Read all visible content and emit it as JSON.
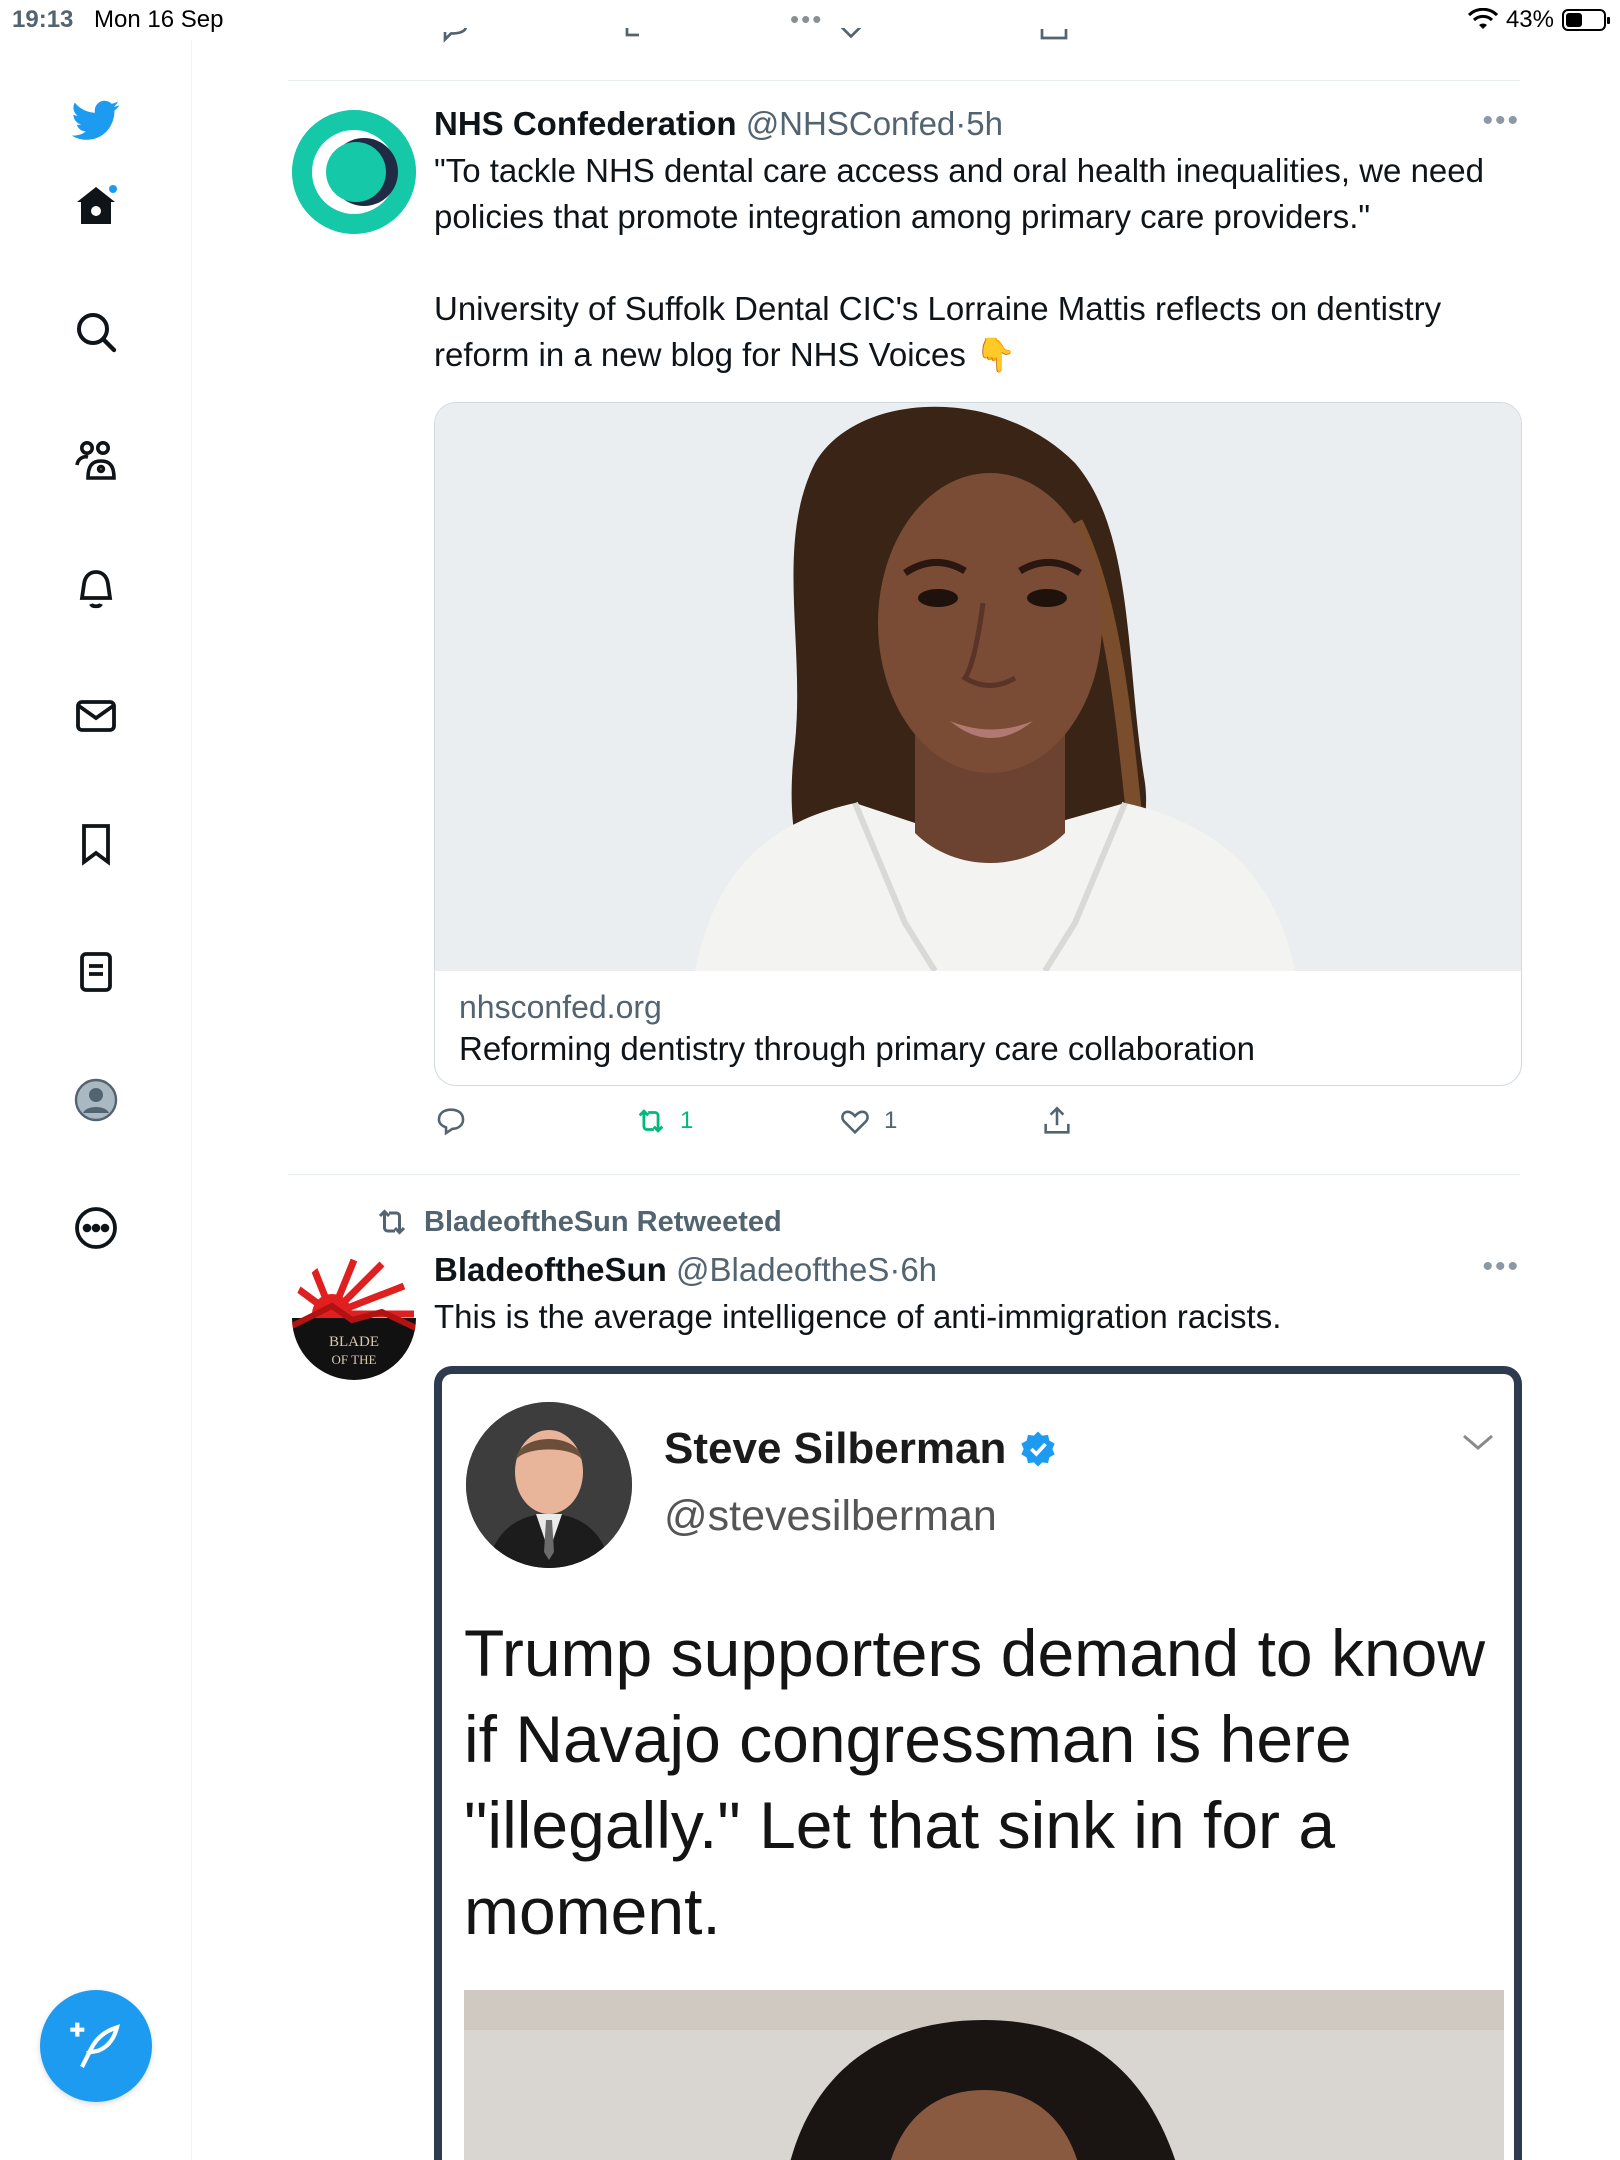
{
  "status_bar": {
    "time": "19:13",
    "date": "Mon 16 Sep",
    "battery": "43%"
  },
  "sidebar": {
    "items": [
      {
        "name": "twitter-logo-icon"
      },
      {
        "name": "home-icon"
      },
      {
        "name": "search-icon"
      },
      {
        "name": "communities-icon"
      },
      {
        "name": "notifications-icon"
      },
      {
        "name": "messages-icon"
      },
      {
        "name": "bookmarks-icon"
      },
      {
        "name": "lists-icon"
      },
      {
        "name": "profile-icon"
      },
      {
        "name": "more-icon"
      }
    ],
    "compose_icon": "compose-tweet-icon"
  },
  "tweets": [
    {
      "name": "NHS Confederation",
      "handle": "@NHSConfed",
      "separator": "·",
      "time": "5h",
      "paragraphs": [
        "\"To tackle NHS dental care access and oral health inequalities, we need policies that promote integration among primary care providers.\"",
        "University of Suffolk Dental CIC's Lorraine Mattis reflects on dentistry reform in a new blog for NHS Voices 👇"
      ],
      "card": {
        "domain": "nhsconfed.org",
        "title": "Reforming dentistry through primary care collaboration"
      },
      "actions": {
        "replies": "",
        "retweets": "1",
        "likes": "1"
      }
    },
    {
      "retweeted_by": "BladeoftheSun Retweeted",
      "name": "BladeoftheSun",
      "handle": "@BladeoftheS",
      "separator": "·",
      "time": "6h",
      "text": "This is the average intelligence of anti-immigration racists.",
      "avatar_text": [
        "BLADE",
        "OF THE"
      ],
      "embedded": {
        "name": "Steve Silberman",
        "handle": "@stevesilberman",
        "text": "Trump supporters demand to know if Navajo congressman is here \"illegally.\" Let that sink in for a moment."
      }
    }
  ],
  "colors": {
    "accent": "#1d9bf0",
    "retweet": "#00ba7c",
    "secondary_text": "#536471",
    "nhs_teal": "#14c8a8"
  }
}
